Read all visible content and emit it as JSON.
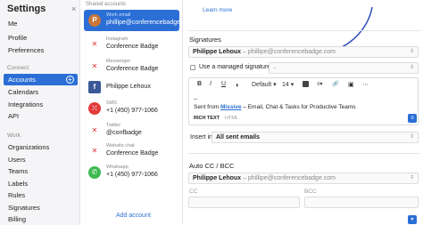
{
  "sidebar": {
    "title": "Settings",
    "close": "×",
    "me_items": [
      "Me",
      "Profile",
      "Preferences"
    ],
    "connect_label": "Connect",
    "connect_items": [
      "Accounts",
      "Calendars",
      "Integrations",
      "API"
    ],
    "work_label": "Work",
    "work_items": [
      "Organizations",
      "Users",
      "Teams",
      "Labels",
      "Rules",
      "Signatures",
      "Billing"
    ],
    "active_item": "Accounts",
    "add_icon": "+"
  },
  "accounts": {
    "header": "Shared accounts",
    "items": [
      {
        "type": "Work email",
        "name": "phillipe@conferencebadge.com",
        "icon": "avatar-icon",
        "color": "#c9763b",
        "glyph": "P",
        "active": true
      },
      {
        "type": "Instagram",
        "name": "Conference Badge",
        "icon": "badge-icon",
        "color": "#ffffff",
        "glyph": "✕",
        "active": false
      },
      {
        "type": "Messenger",
        "name": "Conference Badge",
        "icon": "badge-icon",
        "color": "#ffffff",
        "glyph": "✕",
        "active": false
      },
      {
        "type": "",
        "name": "Philippe Lehoux",
        "icon": "facebook-icon",
        "color": "#3b5998",
        "glyph": "f",
        "active": false
      },
      {
        "type": "SMS",
        "name": "+1 (450) 977-1066",
        "icon": "sms-icon",
        "color": "#e23b3b",
        "glyph": "⁙",
        "active": false
      },
      {
        "type": "Twitter",
        "name": "@confbadge",
        "icon": "badge-icon",
        "color": "#ffffff",
        "glyph": "✕",
        "active": false
      },
      {
        "type": "Website chat",
        "name": "Conference Badge",
        "icon": "badge-icon",
        "color": "#ffffff",
        "glyph": "✕",
        "active": false
      },
      {
        "type": "Whatsapp",
        "name": "+1 (450) 977-1066",
        "icon": "whatsapp-icon",
        "color": "#3fb853",
        "glyph": "✆",
        "active": false
      }
    ],
    "add_label": "Add account"
  },
  "main": {
    "learn_more": "Learn more",
    "signatures_heading": "Signatures",
    "sender_name": "Philippe Lehoux",
    "sender_email": " – phillipe@conferencebadge.com",
    "managed_label": "Use a managed signature:",
    "managed_value": "–",
    "toolbar": {
      "bold": "B",
      "italic": "I",
      "underline": "U",
      "font": "Default",
      "size": "14",
      "link": "🔗",
      "image": "▣",
      "more": "⋯"
    },
    "sig_dash": "--",
    "sig_prefix": "Sent from ",
    "sig_link": "Missive",
    "sig_suffix": " – Email, Chat & Tasks for Productive Teams",
    "tab_rich": "RICH TEXT",
    "tab_html": "HTML",
    "insert_label": "Insert in:",
    "insert_value": "All sent emails",
    "auto_cc_heading": "Auto CC / BCC",
    "cc_label": "CC",
    "bcc_label": "BCC"
  },
  "colors": {
    "accent": "#2b6fd6"
  }
}
